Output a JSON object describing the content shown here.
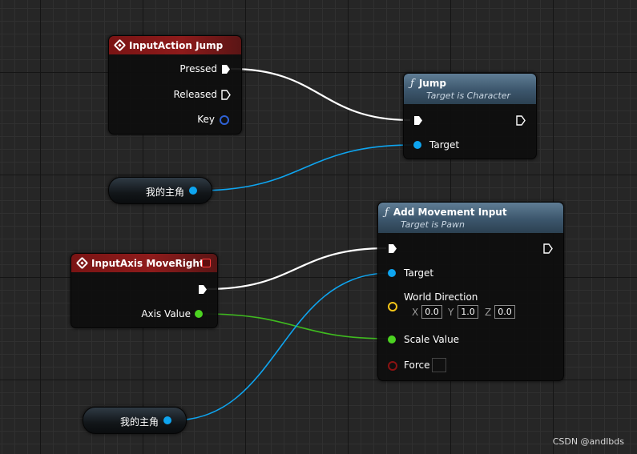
{
  "nodes": {
    "input_action_jump": {
      "title": "InputAction Jump",
      "pins": {
        "pressed": "Pressed",
        "released": "Released",
        "key": "Key"
      }
    },
    "jump": {
      "title": "Jump",
      "subtitle": "Target is Character",
      "pins": {
        "target": "Target"
      }
    },
    "var_main_character_1": {
      "label": "我的主角"
    },
    "input_axis_move_right": {
      "title": "InputAxis MoveRight",
      "pins": {
        "axis_value": "Axis Value"
      }
    },
    "add_movement_input": {
      "title": "Add Movement Input",
      "subtitle": "Target is Pawn",
      "pins": {
        "target": "Target",
        "world_direction": "World Direction",
        "x_label": "X",
        "x_value": "0.0",
        "y_label": "Y",
        "y_value": "1.0",
        "z_label": "Z",
        "z_value": "0.0",
        "scale_value": "Scale Value",
        "force": "Force"
      }
    },
    "var_main_character_2": {
      "label": "我的主角"
    }
  },
  "icons": {
    "function": "function-f-icon",
    "event": "event-diamond-icon",
    "exec_pin": "exec-arrow-icon",
    "data_pin": "data-dot-icon"
  },
  "colors": {
    "exec_wire": "#ffffff",
    "object_pin": "#0ea5f0",
    "float_pin": "#4cd321",
    "vector_pin": "#f5c518",
    "bool_pin": "#8a1212",
    "event_header": "#8e1b1b",
    "function_header": "#4d6a82"
  },
  "watermark": "CSDN @andlbds"
}
